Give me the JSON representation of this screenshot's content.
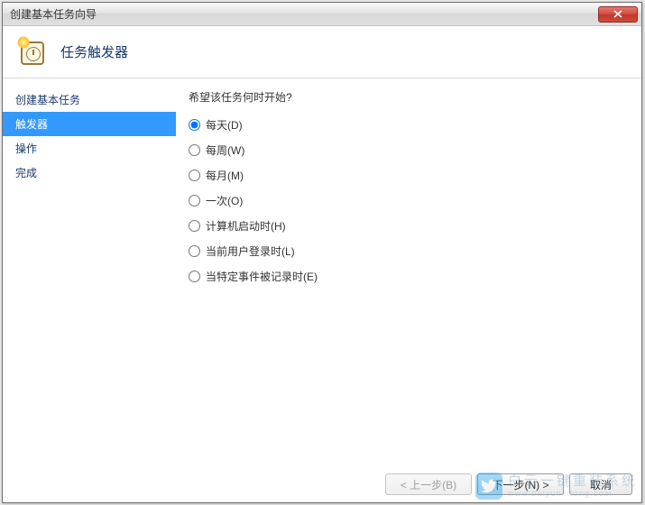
{
  "titlebar": {
    "text": "创建基本任务向导"
  },
  "header": {
    "title": "任务触发器"
  },
  "sidebar": {
    "items": [
      {
        "label": "创建基本任务",
        "selected": false
      },
      {
        "label": "触发器",
        "selected": true
      },
      {
        "label": "操作",
        "selected": false
      },
      {
        "label": "完成",
        "selected": false
      }
    ]
  },
  "main": {
    "prompt": "希望该任务何时开始?",
    "radios": [
      {
        "label": "每天(D)",
        "checked": true
      },
      {
        "label": "每周(W)",
        "checked": false
      },
      {
        "label": "每月(M)",
        "checked": false
      },
      {
        "label": "一次(O)",
        "checked": false
      },
      {
        "label": "计算机启动时(H)",
        "checked": false
      },
      {
        "label": "当前用户登录时(L)",
        "checked": false
      },
      {
        "label": "当特定事件被记录时(E)",
        "checked": false
      }
    ]
  },
  "buttons": {
    "back": "< 上一步(B)",
    "next": "下一步(N) >",
    "cancel": "取消"
  },
  "watermark": {
    "text": "白云一键重装系统",
    "url": "www.baiyunxitong.com"
  }
}
